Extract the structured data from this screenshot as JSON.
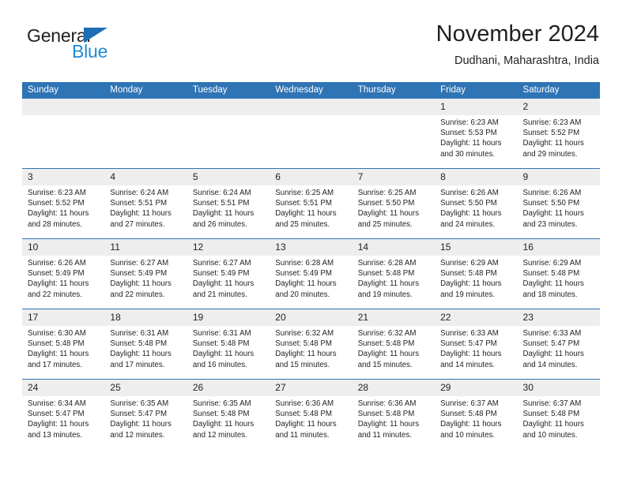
{
  "brand": {
    "name_part1": "General",
    "name_part2": "Blue",
    "accent_color": "#1f8ad6",
    "triangle_color": "#1f6db4"
  },
  "header": {
    "month_title": "November 2024",
    "location": "Dudhani, Maharashtra, India"
  },
  "theme": {
    "header_blue": "#2f74b5",
    "daynum_band": "#eeeeee",
    "text": "#231f20"
  },
  "weekday_headers": [
    "Sunday",
    "Monday",
    "Tuesday",
    "Wednesday",
    "Thursday",
    "Friday",
    "Saturday"
  ],
  "labels": {
    "sunrise_prefix": "Sunrise:",
    "sunset_prefix": "Sunset:",
    "daylight_prefix": "Daylight:"
  },
  "weeks": [
    [
      {
        "day": "",
        "sunrise": "",
        "sunset": "",
        "daylight": "",
        "empty": true
      },
      {
        "day": "",
        "sunrise": "",
        "sunset": "",
        "daylight": "",
        "empty": true
      },
      {
        "day": "",
        "sunrise": "",
        "sunset": "",
        "daylight": "",
        "empty": true
      },
      {
        "day": "",
        "sunrise": "",
        "sunset": "",
        "daylight": "",
        "empty": true
      },
      {
        "day": "",
        "sunrise": "",
        "sunset": "",
        "daylight": "",
        "empty": true
      },
      {
        "day": "1",
        "sunrise": "Sunrise: 6:23 AM",
        "sunset": "Sunset: 5:53 PM",
        "daylight": "Daylight: 11 hours and 30 minutes.",
        "empty": false
      },
      {
        "day": "2",
        "sunrise": "Sunrise: 6:23 AM",
        "sunset": "Sunset: 5:52 PM",
        "daylight": "Daylight: 11 hours and 29 minutes.",
        "empty": false
      }
    ],
    [
      {
        "day": "3",
        "sunrise": "Sunrise: 6:23 AM",
        "sunset": "Sunset: 5:52 PM",
        "daylight": "Daylight: 11 hours and 28 minutes.",
        "empty": false
      },
      {
        "day": "4",
        "sunrise": "Sunrise: 6:24 AM",
        "sunset": "Sunset: 5:51 PM",
        "daylight": "Daylight: 11 hours and 27 minutes.",
        "empty": false
      },
      {
        "day": "5",
        "sunrise": "Sunrise: 6:24 AM",
        "sunset": "Sunset: 5:51 PM",
        "daylight": "Daylight: 11 hours and 26 minutes.",
        "empty": false
      },
      {
        "day": "6",
        "sunrise": "Sunrise: 6:25 AM",
        "sunset": "Sunset: 5:51 PM",
        "daylight": "Daylight: 11 hours and 25 minutes.",
        "empty": false
      },
      {
        "day": "7",
        "sunrise": "Sunrise: 6:25 AM",
        "sunset": "Sunset: 5:50 PM",
        "daylight": "Daylight: 11 hours and 25 minutes.",
        "empty": false
      },
      {
        "day": "8",
        "sunrise": "Sunrise: 6:26 AM",
        "sunset": "Sunset: 5:50 PM",
        "daylight": "Daylight: 11 hours and 24 minutes.",
        "empty": false
      },
      {
        "day": "9",
        "sunrise": "Sunrise: 6:26 AM",
        "sunset": "Sunset: 5:50 PM",
        "daylight": "Daylight: 11 hours and 23 minutes.",
        "empty": false
      }
    ],
    [
      {
        "day": "10",
        "sunrise": "Sunrise: 6:26 AM",
        "sunset": "Sunset: 5:49 PM",
        "daylight": "Daylight: 11 hours and 22 minutes.",
        "empty": false
      },
      {
        "day": "11",
        "sunrise": "Sunrise: 6:27 AM",
        "sunset": "Sunset: 5:49 PM",
        "daylight": "Daylight: 11 hours and 22 minutes.",
        "empty": false
      },
      {
        "day": "12",
        "sunrise": "Sunrise: 6:27 AM",
        "sunset": "Sunset: 5:49 PM",
        "daylight": "Daylight: 11 hours and 21 minutes.",
        "empty": false
      },
      {
        "day": "13",
        "sunrise": "Sunrise: 6:28 AM",
        "sunset": "Sunset: 5:49 PM",
        "daylight": "Daylight: 11 hours and 20 minutes.",
        "empty": false
      },
      {
        "day": "14",
        "sunrise": "Sunrise: 6:28 AM",
        "sunset": "Sunset: 5:48 PM",
        "daylight": "Daylight: 11 hours and 19 minutes.",
        "empty": false
      },
      {
        "day": "15",
        "sunrise": "Sunrise: 6:29 AM",
        "sunset": "Sunset: 5:48 PM",
        "daylight": "Daylight: 11 hours and 19 minutes.",
        "empty": false
      },
      {
        "day": "16",
        "sunrise": "Sunrise: 6:29 AM",
        "sunset": "Sunset: 5:48 PM",
        "daylight": "Daylight: 11 hours and 18 minutes.",
        "empty": false
      }
    ],
    [
      {
        "day": "17",
        "sunrise": "Sunrise: 6:30 AM",
        "sunset": "Sunset: 5:48 PM",
        "daylight": "Daylight: 11 hours and 17 minutes.",
        "empty": false
      },
      {
        "day": "18",
        "sunrise": "Sunrise: 6:31 AM",
        "sunset": "Sunset: 5:48 PM",
        "daylight": "Daylight: 11 hours and 17 minutes.",
        "empty": false
      },
      {
        "day": "19",
        "sunrise": "Sunrise: 6:31 AM",
        "sunset": "Sunset: 5:48 PM",
        "daylight": "Daylight: 11 hours and 16 minutes.",
        "empty": false
      },
      {
        "day": "20",
        "sunrise": "Sunrise: 6:32 AM",
        "sunset": "Sunset: 5:48 PM",
        "daylight": "Daylight: 11 hours and 15 minutes.",
        "empty": false
      },
      {
        "day": "21",
        "sunrise": "Sunrise: 6:32 AM",
        "sunset": "Sunset: 5:48 PM",
        "daylight": "Daylight: 11 hours and 15 minutes.",
        "empty": false
      },
      {
        "day": "22",
        "sunrise": "Sunrise: 6:33 AM",
        "sunset": "Sunset: 5:47 PM",
        "daylight": "Daylight: 11 hours and 14 minutes.",
        "empty": false
      },
      {
        "day": "23",
        "sunrise": "Sunrise: 6:33 AM",
        "sunset": "Sunset: 5:47 PM",
        "daylight": "Daylight: 11 hours and 14 minutes.",
        "empty": false
      }
    ],
    [
      {
        "day": "24",
        "sunrise": "Sunrise: 6:34 AM",
        "sunset": "Sunset: 5:47 PM",
        "daylight": "Daylight: 11 hours and 13 minutes.",
        "empty": false
      },
      {
        "day": "25",
        "sunrise": "Sunrise: 6:35 AM",
        "sunset": "Sunset: 5:47 PM",
        "daylight": "Daylight: 11 hours and 12 minutes.",
        "empty": false
      },
      {
        "day": "26",
        "sunrise": "Sunrise: 6:35 AM",
        "sunset": "Sunset: 5:48 PM",
        "daylight": "Daylight: 11 hours and 12 minutes.",
        "empty": false
      },
      {
        "day": "27",
        "sunrise": "Sunrise: 6:36 AM",
        "sunset": "Sunset: 5:48 PM",
        "daylight": "Daylight: 11 hours and 11 minutes.",
        "empty": false
      },
      {
        "day": "28",
        "sunrise": "Sunrise: 6:36 AM",
        "sunset": "Sunset: 5:48 PM",
        "daylight": "Daylight: 11 hours and 11 minutes.",
        "empty": false
      },
      {
        "day": "29",
        "sunrise": "Sunrise: 6:37 AM",
        "sunset": "Sunset: 5:48 PM",
        "daylight": "Daylight: 11 hours and 10 minutes.",
        "empty": false
      },
      {
        "day": "30",
        "sunrise": "Sunrise: 6:37 AM",
        "sunset": "Sunset: 5:48 PM",
        "daylight": "Daylight: 11 hours and 10 minutes.",
        "empty": false
      }
    ]
  ]
}
